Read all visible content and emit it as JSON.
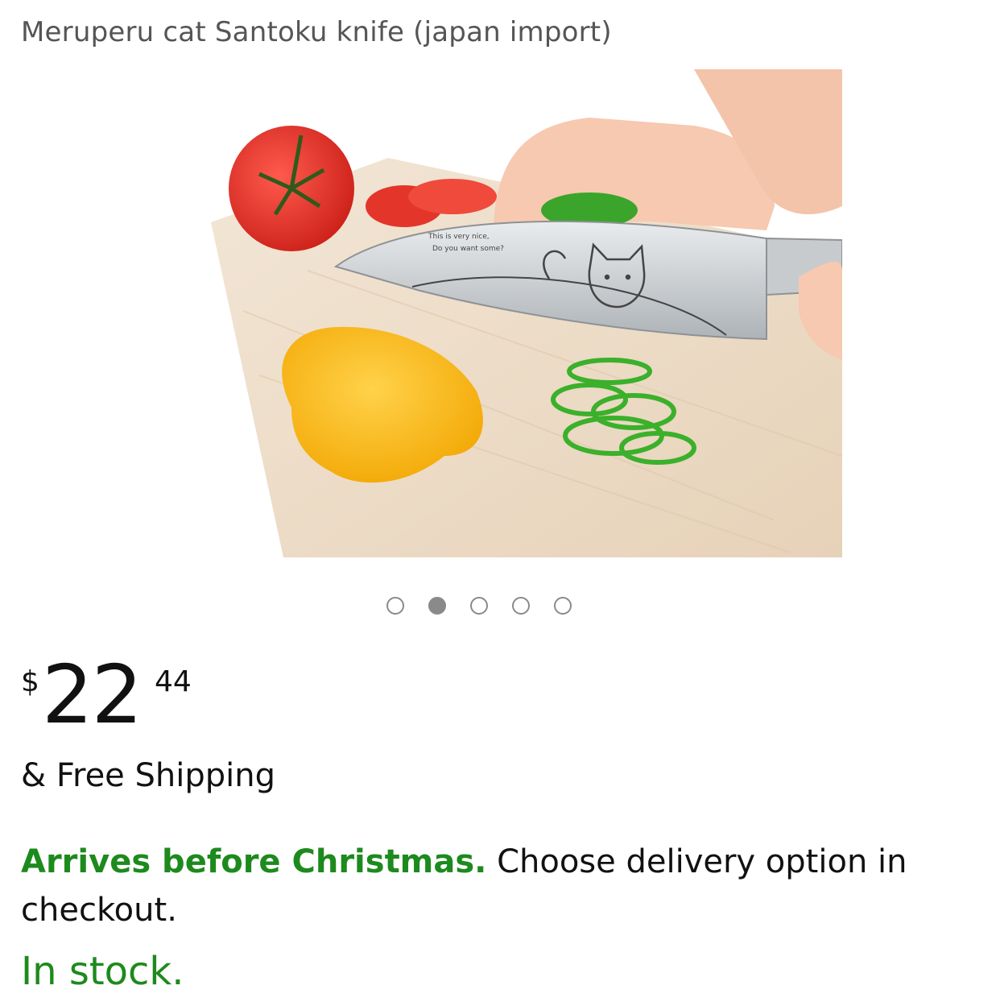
{
  "product": {
    "title": "Meruperu cat Santoku knife (japan import)",
    "image_alt": "Cat santoku knife slicing green peppers next to tomato and yellow pepper",
    "knife_engraving": [
      "This is very nice,",
      "Do you want some?"
    ]
  },
  "carousel": {
    "total": 5,
    "active_index": 1
  },
  "price": {
    "currency": "$",
    "whole": "22",
    "fraction": "44"
  },
  "shipping": "& Free Shipping",
  "delivery": {
    "highlight": "Arrives before Christmas.",
    "rest": " Choose delivery option in checkout."
  },
  "stock": "In stock.",
  "colors": {
    "title_gray": "#555555",
    "success_green": "#1d8a1d",
    "dot_gray": "#8a8a8a"
  }
}
